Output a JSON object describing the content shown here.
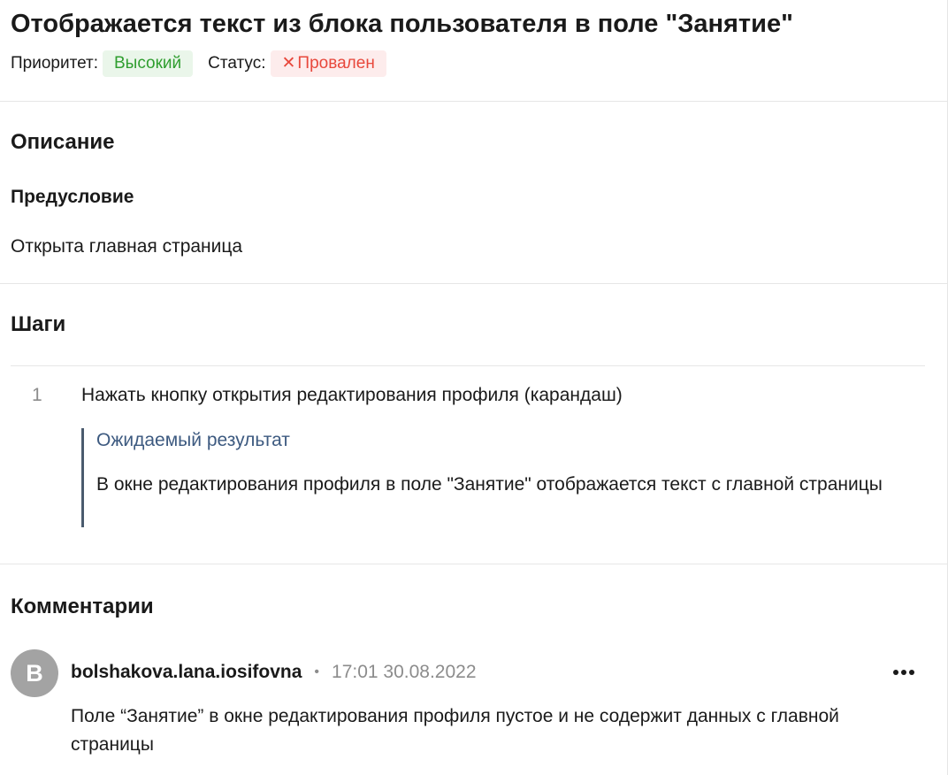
{
  "testcase": {
    "title": "Отображается текст из блока пользователя в поле \"Занятие\"",
    "priority_label": "Приоритет:",
    "priority_value": "Высокий",
    "status_label": "Статус:",
    "status_value": "Провален",
    "status_icon": "x-icon"
  },
  "description": {
    "heading": "Описание",
    "precondition_heading": "Предусловие",
    "precondition_text": "Открыта главная страница"
  },
  "steps": {
    "heading": "Шаги",
    "items": [
      {
        "number": "1",
        "action": "Нажать кнопку открытия редактирования профиля (карандаш)",
        "expected_label": "Ожидаемый результат",
        "expected_text": "В окне редактирования профиля в поле \"Занятие\" отображается текст с главной страницы"
      }
    ]
  },
  "comments": {
    "heading": "Комментарии",
    "items": [
      {
        "avatar_letter": "B",
        "author": "bolshakova.lana.iosifovna",
        "separator": "•",
        "time": "17:01 30.08.2022",
        "text": "Поле “Занятие” в окне редактирования профиля пустое и не содержит данных с главной страницы",
        "more_icon": "more-horizontal-icon"
      }
    ]
  },
  "colors": {
    "priority_bg": "#eaf6ea",
    "priority_text": "#2f9e2f",
    "status_bg": "#fdecec",
    "status_text": "#e8483c",
    "expected_label": "#3d5a80",
    "avatar_bg": "#a3a3a3"
  }
}
